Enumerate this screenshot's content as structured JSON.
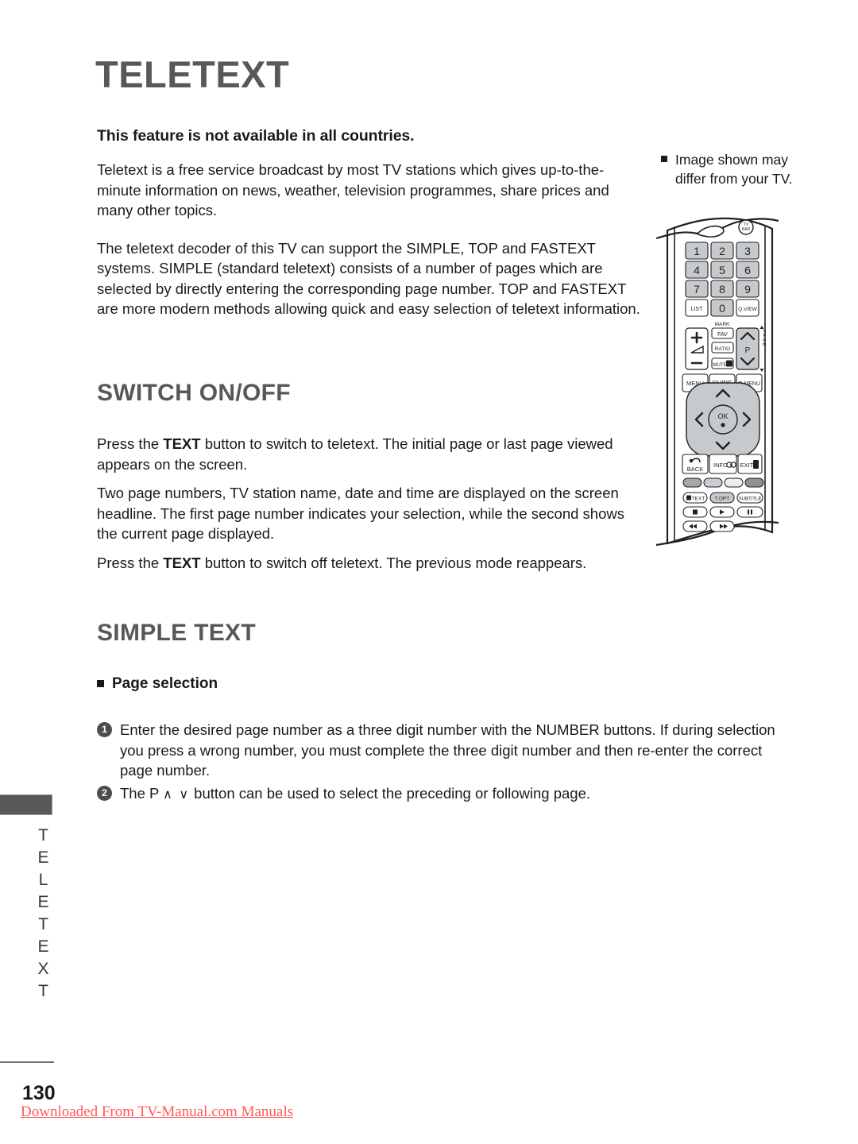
{
  "page": {
    "title": "TELETEXT",
    "side_tab_label": "TELETEXT",
    "page_number": "130",
    "download_note": "Downloaded From TV-Manual.com Manuals"
  },
  "intro": {
    "lead": "This feature is not available in all countries.",
    "para1": "Teletext is a free service broadcast by most TV stations which gives up-to-the-minute information on news, weather, television programmes, share prices and many other topics.",
    "para2": "The teletext decoder of this TV can support the SIMPLE, TOP and FASTEXT systems. SIMPLE (standard teletext) consists of a number of pages which are selected by directly entering the corresponding page number. TOP and FASTEXT are more modern methods allowing quick and easy selection of teletext information."
  },
  "side_note": {
    "text": "Image shown may differ from your TV."
  },
  "switch_section": {
    "heading": "SWITCH ON/OFF",
    "para1_a": "Press the ",
    "para1_b": "TEXT",
    "para1_c": " button to switch to teletext. The initial page or last page viewed appears on the screen.",
    "para2": "Two page numbers, TV station name, date and time are displayed on the screen headline. The first page number indicates your selection, while the second shows the current page displayed.",
    "para3_a": "Press the ",
    "para3_b": "TEXT",
    "para3_c": " button to switch off teletext. The previous mode reappears."
  },
  "simple_section": {
    "heading": "SIMPLE TEXT",
    "subheading": "Page selection",
    "items": [
      {
        "num": "1",
        "text": "Enter the desired page number as a three digit number with the NUMBER buttons. If during selection you press a wrong number, you must complete the three digit number and then re-enter the correct page number."
      },
      {
        "num": "2",
        "text_before": "The P ",
        "arrows": "∧ ∨",
        "text_after": " button can be used to select the preceding or following page."
      }
    ]
  },
  "remote": {
    "tv_rad_label_line1": "TV",
    "tv_rad_label_line2": "RAD",
    "keypad": [
      "1",
      "2",
      "3",
      "4",
      "5",
      "6",
      "7",
      "8",
      "9"
    ],
    "list_label": "LIST",
    "zero_label": "0",
    "qview_label": "Q.VIEW",
    "mark_label": "MARK",
    "fav_label": "FAV",
    "ratio_label": "RATIO",
    "mute_label": "MUTE",
    "p_label": "P",
    "page_side_label": "PAGE",
    "menu_label": "MENU",
    "guide_label": "GUIDE",
    "qmenu_label": "Q.MENU",
    "ok_label": "OK",
    "back_label": "BACK",
    "info_label": "INFO",
    "exit_label": "EXIT",
    "text_label": "TEXT",
    "topt_label": "T.OPT",
    "subtitle_label": "SUBTITLE",
    "colors": {
      "body_fill": "#ffffff",
      "body_stroke": "#231f20",
      "key_fill": "#c7cacd",
      "pad_fill": "#c7cacd",
      "color_btn_1": "#a3a6aa",
      "color_btn_2": "#c9ccd0",
      "color_btn_3": "#eceef0",
      "color_btn_4": "#8e9196"
    }
  },
  "theme": {
    "heading_gray": "#58585a",
    "text_black": "#1a1a1a",
    "link_red": "#ff5a5a"
  }
}
